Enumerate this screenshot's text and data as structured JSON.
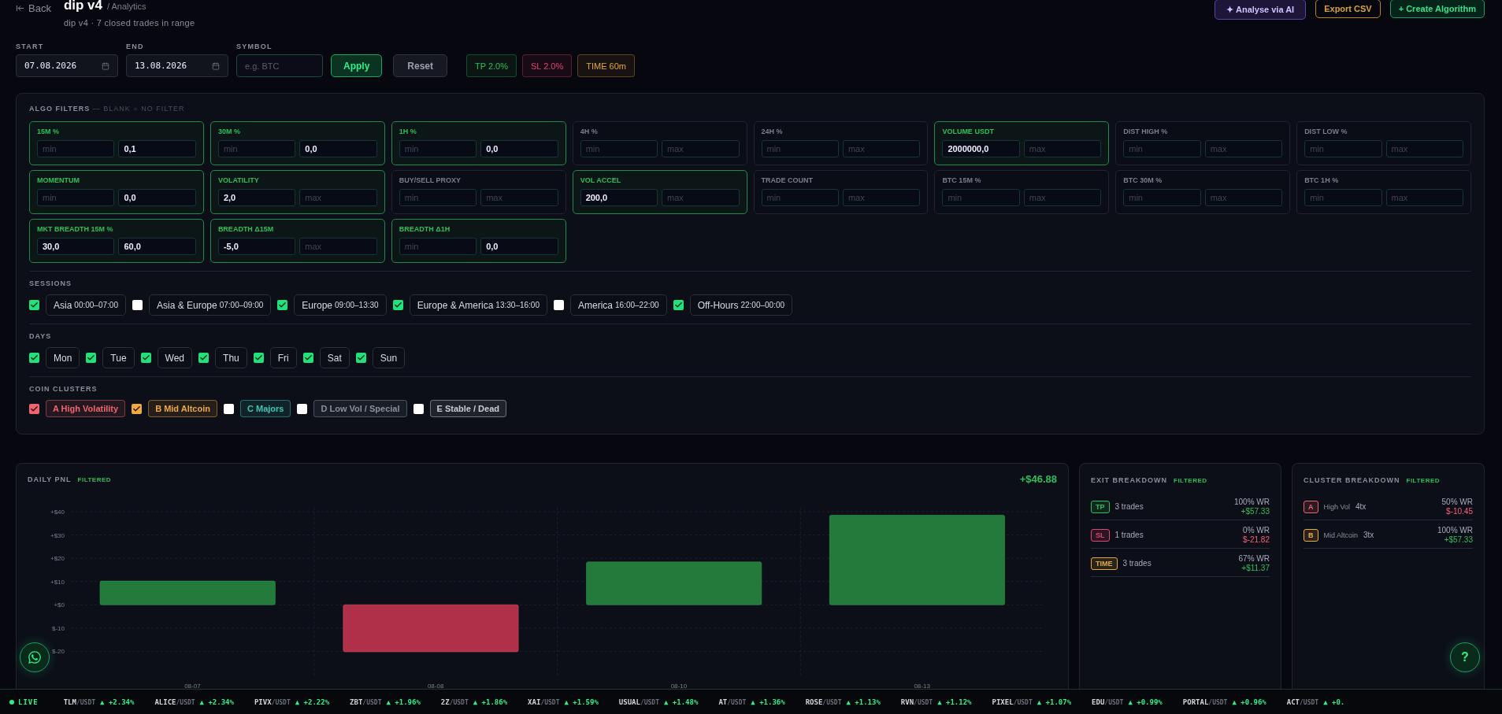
{
  "header": {
    "back": "Back",
    "title": "dip v4",
    "crumb": "/ Analytics",
    "subtitle": "dip v4 · 7 closed trades in range"
  },
  "actions": [
    {
      "label": "✦ Analyse via AI",
      "kind": "ai"
    },
    {
      "label": "Export CSV",
      "kind": "export"
    },
    {
      "label": "+ Create Algorithm",
      "kind": "create"
    }
  ],
  "range": {
    "fields": [
      {
        "label": "START",
        "value": "07.08.2026",
        "kind": "date"
      },
      {
        "label": "END",
        "value": "13.08.2026",
        "kind": "date"
      },
      {
        "label": "SYMBOL",
        "placeholder": "e.g. BTC",
        "kind": "text"
      }
    ],
    "buttons": [
      {
        "label": "Apply",
        "kind": "primary"
      },
      {
        "label": "Reset",
        "kind": "plain"
      }
    ],
    "chips": [
      {
        "label": "TP 2.0%",
        "color": "#2fbf5a"
      },
      {
        "label": "SL 2.0%",
        "color": "#e0456e"
      },
      {
        "label": "TIME 60m",
        "color": "#e0a83a"
      }
    ]
  },
  "filters": {
    "title": "ALGO FILTERS",
    "hint": "— BLANK = NO FILTER",
    "cards": [
      {
        "label": "15M %",
        "active": true,
        "inputs": [
          {
            "placeholder": "min"
          },
          {
            "value": "0,1"
          }
        ]
      },
      {
        "label": "30M %",
        "active": true,
        "inputs": [
          {
            "placeholder": "min"
          },
          {
            "value": "0,0"
          }
        ]
      },
      {
        "label": "1H %",
        "active": true,
        "inputs": [
          {
            "placeholder": "min"
          },
          {
            "value": "0,0"
          }
        ]
      },
      {
        "label": "4H %",
        "active": false,
        "inputs": [
          {
            "placeholder": "min"
          },
          {
            "placeholder": "max"
          }
        ]
      },
      {
        "label": "24H %",
        "active": false,
        "inputs": [
          {
            "placeholder": "min"
          },
          {
            "placeholder": "max"
          }
        ]
      },
      {
        "label": "VOLUME USDT",
        "active": true,
        "inputs": [
          {
            "value": "2000000,0"
          },
          {
            "placeholder": "max"
          }
        ]
      },
      {
        "label": "DIST HIGH %",
        "active": false,
        "inputs": [
          {
            "placeholder": "min"
          },
          {
            "placeholder": "max"
          }
        ]
      },
      {
        "label": "DIST LOW %",
        "active": false,
        "inputs": [
          {
            "placeholder": "min"
          },
          {
            "placeholder": "max"
          }
        ]
      },
      {
        "label": "MOMENTUM",
        "active": true,
        "inputs": [
          {
            "placeholder": "min"
          },
          {
            "value": "0,0"
          }
        ]
      },
      {
        "label": "VOLATILITY",
        "active": true,
        "inputs": [
          {
            "value": "2,0"
          },
          {
            "placeholder": "max"
          }
        ]
      },
      {
        "label": "BUY/SELL PROXY",
        "active": false,
        "inputs": [
          {
            "placeholder": "min"
          },
          {
            "placeholder": "max"
          }
        ]
      },
      {
        "label": "VOL ACCEL",
        "active": true,
        "inputs": [
          {
            "value": "200,0"
          },
          {
            "placeholder": "max"
          }
        ]
      },
      {
        "label": "TRADE COUNT",
        "active": false,
        "inputs": [
          {
            "placeholder": "min"
          },
          {
            "placeholder": "max"
          }
        ]
      },
      {
        "label": "BTC 15M %",
        "active": false,
        "inputs": [
          {
            "placeholder": "min"
          },
          {
            "placeholder": "max"
          }
        ]
      },
      {
        "label": "BTC 30M %",
        "active": false,
        "inputs": [
          {
            "placeholder": "min"
          },
          {
            "placeholder": "max"
          }
        ]
      },
      {
        "label": "BTC 1H %",
        "active": false,
        "inputs": [
          {
            "placeholder": "min"
          },
          {
            "placeholder": "max"
          }
        ]
      },
      {
        "label": "MKT BREADTH 15M %",
        "active": true,
        "inputs": [
          {
            "value": "30,0"
          },
          {
            "value": "60,0"
          }
        ]
      },
      {
        "label": "BREADTH Δ15M",
        "active": true,
        "inputs": [
          {
            "value": "-5,0"
          },
          {
            "placeholder": "max"
          }
        ]
      },
      {
        "label": "BREADTH Δ1H",
        "active": true,
        "inputs": [
          {
            "placeholder": "min"
          },
          {
            "value": "0,0"
          }
        ]
      }
    ],
    "sessions": {
      "title": "SESSIONS",
      "items": [
        {
          "name": "Asia",
          "time": "00:00–07:00",
          "checked": true
        },
        {
          "name": "Asia & Europe",
          "time": "07:00–09:00",
          "checked": false
        },
        {
          "name": "Europe",
          "time": "09:00–13:30",
          "checked": true
        },
        {
          "name": "Europe & America",
          "time": "13:30–16:00",
          "checked": true
        },
        {
          "name": "America",
          "time": "16:00–22:00",
          "checked": false
        },
        {
          "name": "Off-Hours",
          "time": "22:00–00:00",
          "checked": true
        }
      ]
    },
    "days": {
      "title": "DAYS",
      "items": [
        {
          "label": "Mon",
          "checked": true
        },
        {
          "label": "Tue",
          "checked": true
        },
        {
          "label": "Wed",
          "checked": true
        },
        {
          "label": "Thu",
          "checked": true
        },
        {
          "label": "Fri",
          "checked": true
        },
        {
          "label": "Sat",
          "checked": true
        },
        {
          "label": "Sun",
          "checked": true
        }
      ]
    },
    "clusters": {
      "title": "COIN CLUSTERS",
      "items": [
        {
          "label": "A High Volatility",
          "checked": true,
          "color": "#f06470"
        },
        {
          "label": "B Mid Altcoin",
          "checked": true,
          "color": "#f0a840"
        },
        {
          "label": "C Majors",
          "checked": false,
          "color": "#3cc8b4"
        },
        {
          "label": "D Low Vol / Special",
          "checked": false,
          "color": "#8a8f99"
        },
        {
          "label": "E Stable / Dead",
          "checked": false,
          "color": "#c8ccd4"
        }
      ]
    }
  },
  "daily_pnl": {
    "badge": "FILTERED",
    "total": "+$46.88",
    "chart_data": {
      "type": "bar",
      "title": "DAILY PNL",
      "categories": [
        "08-07",
        "08-08",
        "08-10",
        "08-13"
      ],
      "values": [
        10.2,
        -20.2,
        18.4,
        38.5
      ],
      "ylim": [
        -30,
        40
      ],
      "grid": true,
      "yticks": [
        {
          "value": 40,
          "label": "+$40"
        },
        {
          "value": 30,
          "label": "+$30"
        },
        {
          "value": 20,
          "label": "+$20"
        },
        {
          "value": 10,
          "label": "+$10"
        },
        {
          "value": 0,
          "label": "+$0"
        },
        {
          "value": -10,
          "label": "$-10"
        },
        {
          "value": -20,
          "label": "$-20"
        }
      ]
    }
  },
  "exit_breakdown": {
    "title": "EXIT BREAKDOWN",
    "badge": "FILTERED",
    "rows": [
      {
        "tag": "TP",
        "color": "#2fbf5a",
        "trades": "3 trades",
        "wr": "100% WR",
        "pnl": "+$57.33",
        "kind": "gain"
      },
      {
        "tag": "SL",
        "color": "#e0456e",
        "trades": "1 trades",
        "wr": "0% WR",
        "pnl": "$-21.82",
        "kind": "loss"
      },
      {
        "tag": "TIME",
        "color": "#e0a83a",
        "trades": "3 trades",
        "wr": "67% WR",
        "pnl": "+$11.37",
        "kind": "gain"
      }
    ]
  },
  "cluster_breakdown": {
    "title": "CLUSTER BREAKDOWN",
    "badge": "FILTERED",
    "rows": [
      {
        "tag": "A",
        "color": "#f06470",
        "name": "High Vol",
        "count": "4tx",
        "wr": "50% WR",
        "pnl": "$-10.45",
        "kind": "loss"
      },
      {
        "tag": "B",
        "color": "#f0a840",
        "name": "Mid Altcoin",
        "count": "3tx",
        "wr": "100% WR",
        "pnl": "+$57.33",
        "kind": "gain"
      }
    ]
  },
  "help_button": "?",
  "ticker": {
    "live": "LIVE",
    "items": [
      {
        "symbol": "TLM",
        "quote": "/USDT",
        "change": "▲ +2.34%"
      },
      {
        "symbol": "ALICE",
        "quote": "/USDT",
        "change": "▲ +2.34%"
      },
      {
        "symbol": "PIVX",
        "quote": "/USDT",
        "change": "▲ +2.22%"
      },
      {
        "symbol": "ZBT",
        "quote": "/USDT",
        "change": "▲ +1.96%"
      },
      {
        "symbol": "2Z",
        "quote": "/USDT",
        "change": "▲ +1.86%"
      },
      {
        "symbol": "XAI",
        "quote": "/USDT",
        "change": "▲ +1.59%"
      },
      {
        "symbol": "USUAL",
        "quote": "/USDT",
        "change": "▲ +1.48%"
      },
      {
        "symbol": "AT",
        "quote": "/USDT",
        "change": "▲ +1.36%"
      },
      {
        "symbol": "ROSE",
        "quote": "/USDT",
        "change": "▲ +1.13%"
      },
      {
        "symbol": "RVN",
        "quote": "/USDT",
        "change": "▲ +1.12%"
      },
      {
        "symbol": "PIXEL",
        "quote": "/USDT",
        "change": "▲ +1.07%"
      },
      {
        "symbol": "EDU",
        "quote": "/USDT",
        "change": "▲ +0.99%"
      },
      {
        "symbol": "PORTAL",
        "quote": "/USDT",
        "change": "▲ +0.96%"
      },
      {
        "symbol": "ACT",
        "quote": "/USDT",
        "change": "▲ +0."
      }
    ]
  }
}
